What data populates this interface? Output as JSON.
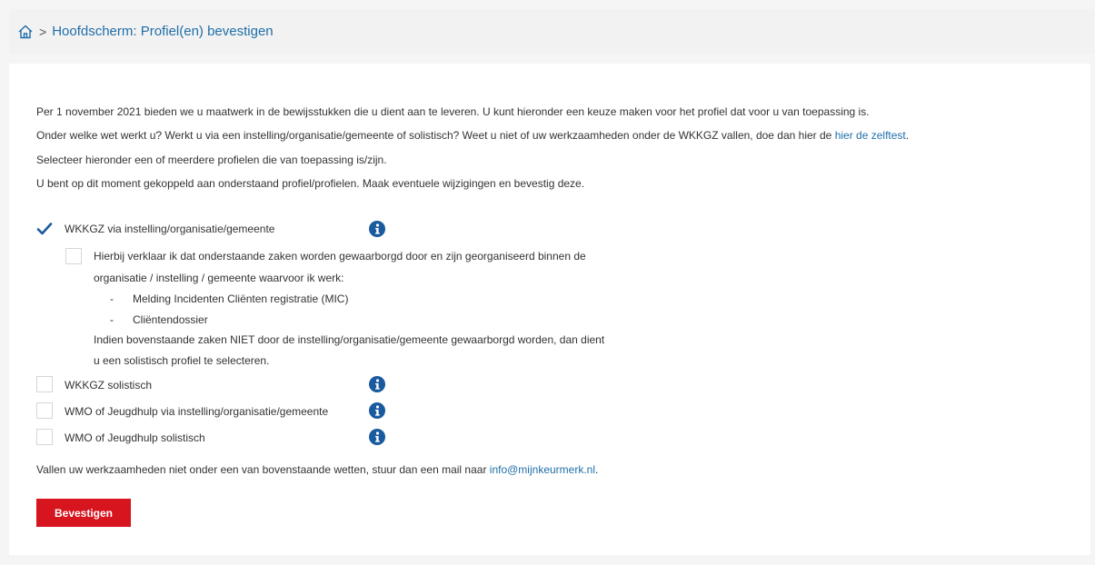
{
  "breadcrumb": {
    "separator": ">",
    "title": "Hoofdscherm: Profiel(en) bevestigen"
  },
  "intro": {
    "line1": "Per 1 november 2021 bieden we u maatwerk in de bewijsstukken die u dient aan te leveren. U kunt hieronder een keuze maken voor het profiel dat voor u van toepassing is.",
    "line2_text": "Onder welke wet werkt u? Werkt u via een instelling/organisatie/gemeente of solistisch? Weet u niet of uw werkzaamheden onder de WKKGZ vallen, doe dan hier de ",
    "line2_link": "hier de zelftest",
    "line2_end": ".",
    "line3": "Selecteer hieronder een of meerdere profielen die van toepassing is/zijn.",
    "line4": "U bent op dit moment gekoppeld aan onderstaand profiel/profielen. Maak eventuele wijzigingen en bevestig deze."
  },
  "profiles": [
    {
      "label": "WKKGZ via instelling/organisatie/gemeente",
      "checked": true
    },
    {
      "label": "WKKGZ solistisch",
      "checked": false
    },
    {
      "label": "WMO of Jeugdhulp via instelling/organisatie/gemeente",
      "checked": false
    },
    {
      "label": "WMO of Jeugdhulp solistisch",
      "checked": false
    }
  ],
  "declaration": {
    "checked": false,
    "line1": "Hierbij verklaar ik dat onderstaande zaken worden gewaarborgd door en zijn georganiseerd binnen de",
    "line2": "organisatie / instelling / gemeente waarvoor ik werk:",
    "bullet_marker": "-",
    "bullets": [
      "Melding Incidenten Cliënten registratie (MIC)",
      "Cliëntendossier"
    ],
    "line3": "Indien bovenstaande zaken NIET door de instelling/organisatie/gemeente gewaarborgd worden, dan dient",
    "line4": "u een solistisch profiel te selecteren."
  },
  "footer": {
    "text": "Vallen uw werkzaamheden niet onder een van bovenstaande wetten, stuur dan een mail naar ",
    "email": "info@mijnkeurmerk.nl",
    "end": "."
  },
  "submit_label": "Bevestigen",
  "colors": {
    "link": "#1f6fa8",
    "button": "#d7151e",
    "info_icon": "#1a5a9e",
    "checkmark": "#1a5a9e"
  },
  "icons": {
    "home": "home-icon",
    "info": "info-icon",
    "check": "checkmark-icon"
  }
}
